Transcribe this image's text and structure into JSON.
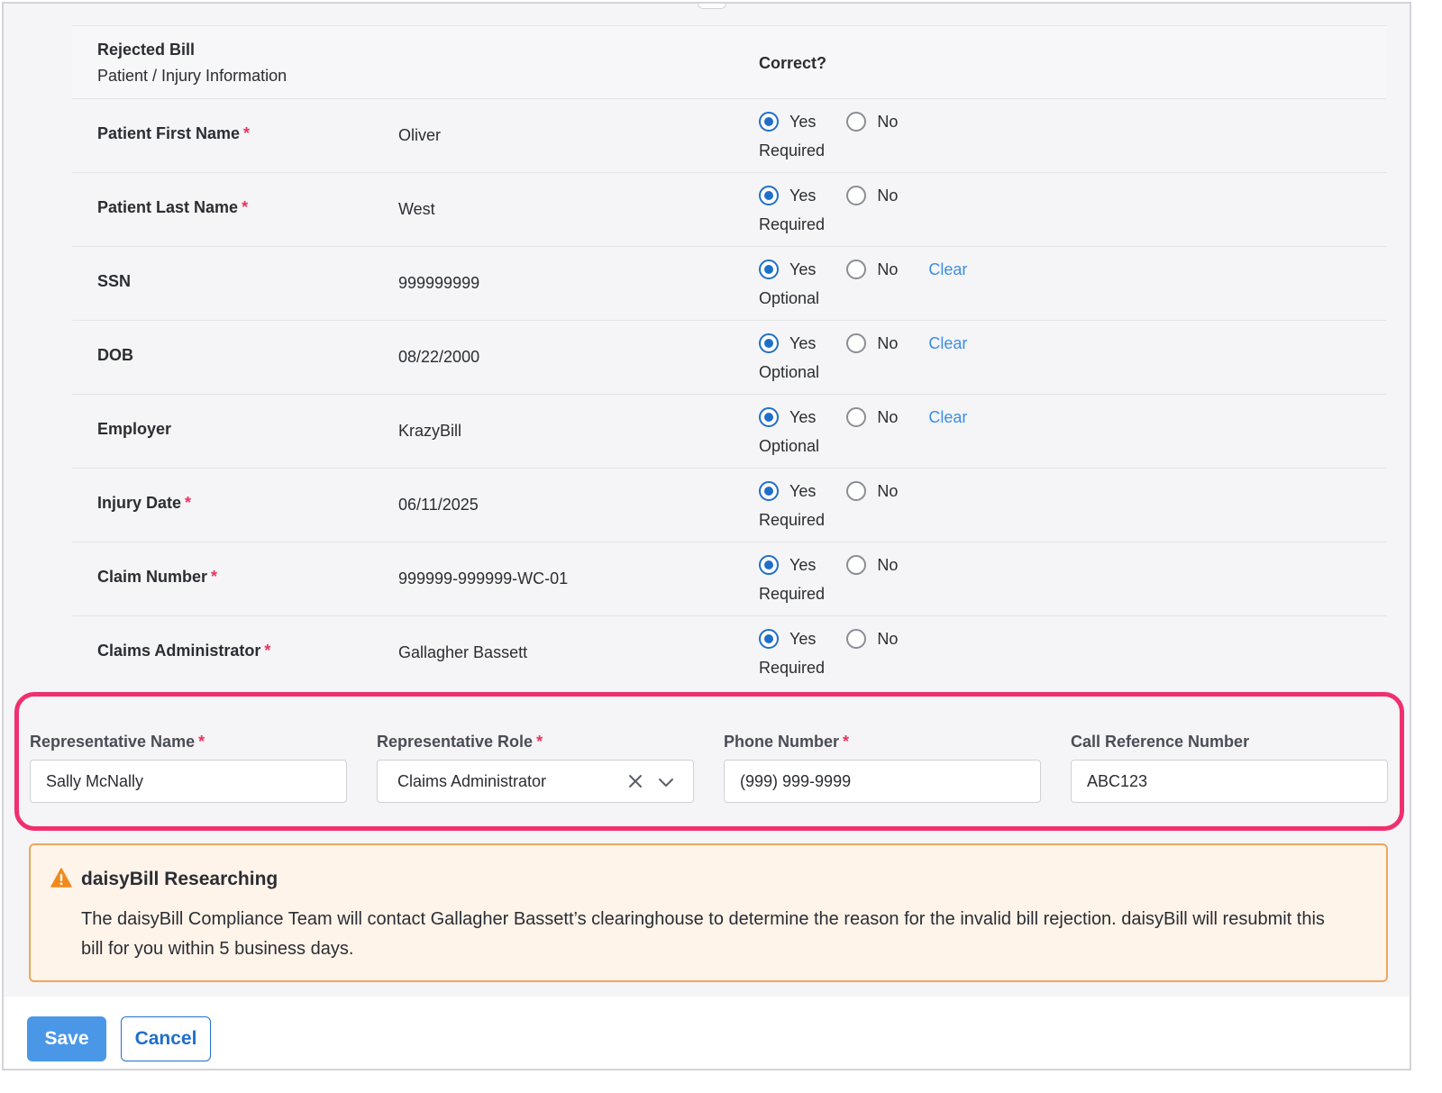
{
  "header": {
    "title": "Rejected Bill",
    "subtitle": "Patient / Injury Information",
    "correct_label": "Correct?"
  },
  "radio_labels": {
    "yes": "Yes",
    "no": "No",
    "clear": "Clear"
  },
  "rows": [
    {
      "label": "Patient First Name",
      "required": true,
      "value": "Oliver",
      "selected": "Yes",
      "status": "Required",
      "clearable": false
    },
    {
      "label": "Patient Last Name",
      "required": true,
      "value": "West",
      "selected": "Yes",
      "status": "Required",
      "clearable": false
    },
    {
      "label": "SSN",
      "required": false,
      "value": "999999999",
      "selected": "Yes",
      "status": "Optional",
      "clearable": true
    },
    {
      "label": "DOB",
      "required": false,
      "value": "08/22/2000",
      "selected": "Yes",
      "status": "Optional",
      "clearable": true
    },
    {
      "label": "Employer",
      "required": false,
      "value": "KrazyBill",
      "selected": "Yes",
      "status": "Optional",
      "clearable": true
    },
    {
      "label": "Injury Date",
      "required": true,
      "value": "06/11/2025",
      "selected": "Yes",
      "status": "Required",
      "clearable": false
    },
    {
      "label": "Claim Number",
      "required": true,
      "value": "999999-999999-WC-01",
      "selected": "Yes",
      "status": "Required",
      "clearable": false
    },
    {
      "label": "Claims Administrator",
      "required": true,
      "value": "Gallagher Bassett",
      "selected": "Yes",
      "status": "Required",
      "clearable": false
    }
  ],
  "representative": {
    "name_label": "Representative Name",
    "name_value": "Sally McNally",
    "role_label": "Representative Role",
    "role_value": "Claims Administrator",
    "phone_label": "Phone Number",
    "phone_value": "(999) 999-9999",
    "ref_label": "Call Reference Number",
    "ref_value": "ABC123"
  },
  "notice": {
    "title": "daisyBill Researching",
    "body": "The daisyBill Compliance Team will contact Gallagher Bassett’s clearinghouse to determine the reason for the invalid bill rejection. daisyBill will resubmit this bill for you within 5 business days."
  },
  "footer": {
    "save_label": "Save",
    "cancel_label": "Cancel"
  },
  "colors": {
    "accent": "#1f6fc9",
    "required_star": "#e8335e",
    "highlight_border": "#f0306e",
    "notice_border": "#f0a65a",
    "notice_bg": "#fff4ea",
    "warning_icon": "#f08a1c"
  }
}
